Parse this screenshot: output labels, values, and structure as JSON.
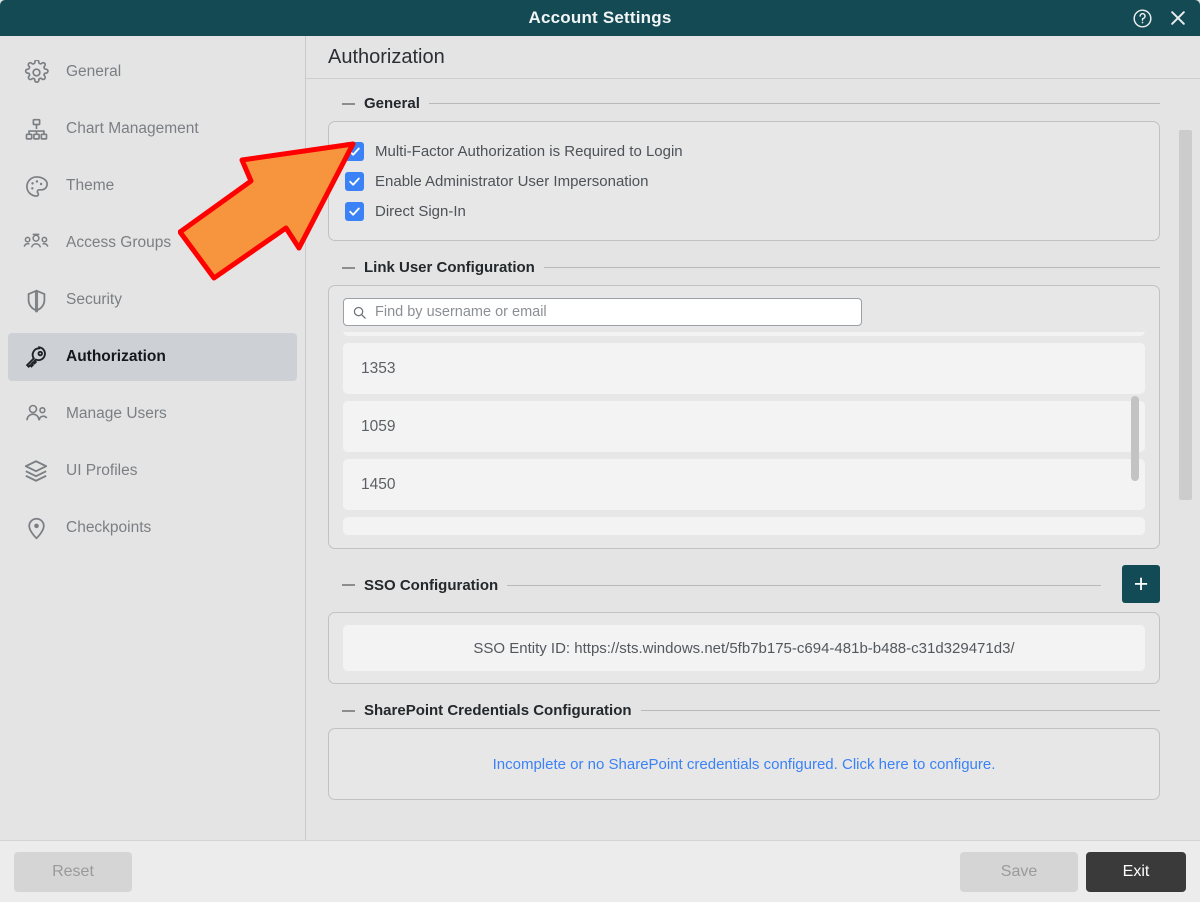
{
  "window": {
    "title": "Account Settings",
    "help_icon": "help-circle-icon",
    "close_icon": "close-icon",
    "titlebar_color": "#134a54"
  },
  "sidebar": {
    "items": [
      {
        "label": "General",
        "icon": "gear-icon",
        "active": false
      },
      {
        "label": "Chart Management",
        "icon": "org-chart-icon",
        "active": false
      },
      {
        "label": "Theme",
        "icon": "palette-icon",
        "active": false
      },
      {
        "label": "Access Groups",
        "icon": "user-group-icon",
        "active": false
      },
      {
        "label": "Security",
        "icon": "shield-icon",
        "active": false
      },
      {
        "label": "Authorization",
        "icon": "key-icon",
        "active": true
      },
      {
        "label": "Manage Users",
        "icon": "users-icon",
        "active": false
      },
      {
        "label": "UI Profiles",
        "icon": "layers-icon",
        "active": false
      },
      {
        "label": "Checkpoints",
        "icon": "map-pin-icon",
        "active": false
      }
    ]
  },
  "main": {
    "title": "Authorization",
    "general": {
      "legend": "General",
      "checkboxes": [
        {
          "label": "Multi-Factor Authorization is Required to Login",
          "checked": true
        },
        {
          "label": "Enable Administrator User Impersonation",
          "checked": true
        },
        {
          "label": "Direct Sign-In",
          "checked": true
        }
      ],
      "checkbox_color": "#3b82f6"
    },
    "link_user": {
      "legend": "Link User Configuration",
      "search_placeholder": "Find by username or email",
      "search_value": "",
      "search_icon": "search-icon",
      "users": [
        "1353",
        "1059",
        "1450"
      ]
    },
    "sso": {
      "legend": "SSO Configuration",
      "add_label": "+",
      "entity_id": "SSO Entity ID: https://sts.windows.net/5fb7b175-c694-481b-b488-c31d329471d3/"
    },
    "sharepoint": {
      "legend": "SharePoint Credentials Configuration",
      "message": "Incomplete or no SharePoint credentials configured. Click here to configure.",
      "message_color": "#3b82f6"
    }
  },
  "footer": {
    "reset_label": "Reset",
    "save_label": "Save",
    "exit_label": "Exit"
  },
  "annotation": {
    "arrow": "orange-arrow-pointer",
    "fill": "#F7943E",
    "stroke": "#FF0000"
  }
}
